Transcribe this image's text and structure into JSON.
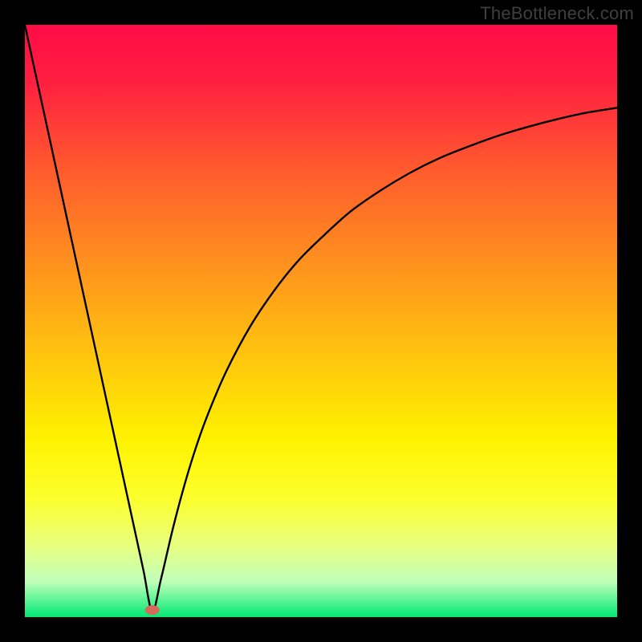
{
  "watermark": "TheBottleneck.com",
  "chart_data": {
    "type": "line",
    "title": "",
    "xlabel": "",
    "ylabel": "",
    "xlim": [
      0,
      100
    ],
    "ylim": [
      0,
      100
    ],
    "grid": false,
    "legend": false,
    "background_gradient": {
      "stops": [
        {
          "offset": 0.0,
          "color": "#ff0b46"
        },
        {
          "offset": 0.1,
          "color": "#ff2140"
        },
        {
          "offset": 0.25,
          "color": "#ff5d2d"
        },
        {
          "offset": 0.4,
          "color": "#ff901e"
        },
        {
          "offset": 0.55,
          "color": "#ffc20f"
        },
        {
          "offset": 0.7,
          "color": "#fff200"
        },
        {
          "offset": 0.8,
          "color": "#fcff2d"
        },
        {
          "offset": 0.88,
          "color": "#e8ff80"
        },
        {
          "offset": 0.94,
          "color": "#c0ffba"
        },
        {
          "offset": 1.0,
          "color": "#00e974"
        }
      ]
    },
    "marker": {
      "x": 21.5,
      "y": 1.2,
      "color": "#d66a5a"
    },
    "series": [
      {
        "name": "curve",
        "x": [
          0,
          2,
          4,
          6,
          8,
          10,
          12,
          14,
          16,
          18,
          20,
          21.5,
          23,
          25,
          27,
          29,
          31,
          34,
          38,
          42,
          46,
          50,
          55,
          60,
          65,
          70,
          75,
          80,
          85,
          90,
          95,
          100
        ],
        "y": [
          100,
          90.8,
          81.6,
          72.4,
          63.2,
          54.0,
          44.8,
          35.6,
          26.4,
          17.2,
          8.0,
          1.0,
          6.5,
          15.0,
          22.5,
          29.0,
          34.5,
          41.5,
          49.0,
          55.0,
          60.0,
          64.0,
          68.5,
          72.0,
          75.0,
          77.5,
          79.5,
          81.3,
          82.8,
          84.1,
          85.2,
          86.0
        ]
      }
    ]
  }
}
